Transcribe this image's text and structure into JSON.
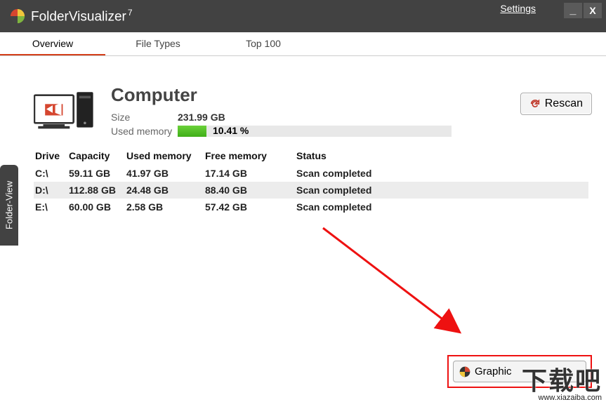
{
  "app": {
    "name": "FolderVisualizer",
    "version": "7"
  },
  "titlebar": {
    "settings": "Settings",
    "minimize": "_",
    "close": "X"
  },
  "tabs": {
    "overview": "Overview",
    "filetypes": "File Types",
    "top100": "Top 100"
  },
  "sidebar": {
    "folderview": "Folder-View"
  },
  "header": {
    "title": "Computer",
    "size_label": "Size",
    "size_value": "231.99 GB",
    "used_label": "Used memory",
    "used_percent": "10.41 %",
    "used_fraction": 0.1041
  },
  "rescan": {
    "label": "Rescan"
  },
  "table": {
    "columns": {
      "drive": "Drive",
      "capacity": "Capacity",
      "used": "Used memory",
      "free": "Free memory",
      "status": "Status"
    },
    "rows": [
      {
        "drive": "C:\\",
        "capacity": "59.11 GB",
        "used": "41.97 GB",
        "free": "17.14 GB",
        "status": "Scan completed"
      },
      {
        "drive": "D:\\",
        "capacity": "112.88 GB",
        "used": "24.48 GB",
        "free": "88.40 GB",
        "status": "Scan completed"
      },
      {
        "drive": "E:\\",
        "capacity": "60.00 GB",
        "used": "2.58 GB",
        "free": "57.42 GB",
        "status": "Scan completed"
      }
    ]
  },
  "graphic": {
    "label": "Graphic"
  },
  "watermark": {
    "text": "下载吧",
    "url": "www.xiazaiba.com"
  }
}
